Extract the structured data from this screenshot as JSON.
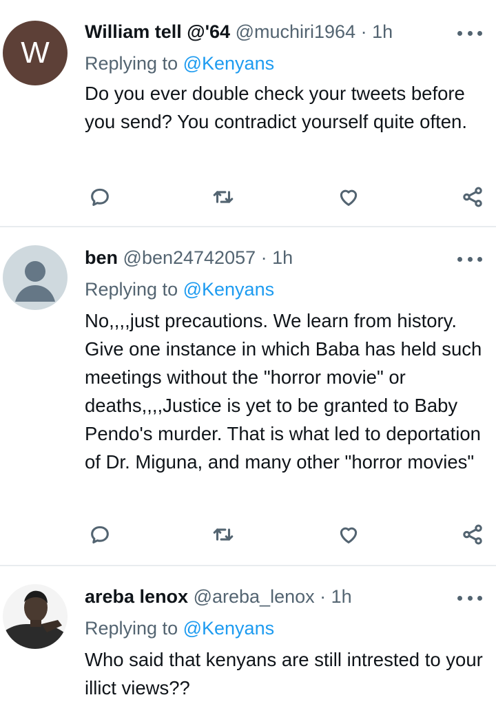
{
  "tweets": [
    {
      "avatar_letter": "W",
      "avatar_color": "#5d4037",
      "display_name": "William tell @'64",
      "handle": "@muchiri1964",
      "separator": "·",
      "time": "1h",
      "replying_prefix": "Replying to",
      "replying_to": "@Kenyans",
      "text": "Do you ever double check your tweets before you send?  You contradict yourself quite often."
    },
    {
      "avatar_color": "#cfd9de",
      "display_name": "ben",
      "handle": "@ben24742057",
      "separator": "·",
      "time": "1h",
      "replying_prefix": "Replying to",
      "replying_to": "@Kenyans",
      "text": "No,,,,just precautions. We learn from history. Give one instance in which Baba has held such meetings without the \"horror movie\" or deaths,,,,Justice is yet to be granted to Baby Pendo's murder. That is what led to deportation of Dr. Miguna, and many other \"horror movies\""
    },
    {
      "display_name": "areba lenox",
      "handle": "@areba_lenox",
      "separator": "·",
      "time": "1h",
      "replying_prefix": "Replying to",
      "replying_to": "@Kenyans",
      "text": "Who said that kenyans are still intrested to your illict views??"
    }
  ],
  "icons": {
    "reply": "reply-icon",
    "retweet": "retweet-icon",
    "like": "heart-icon",
    "share": "share-icon",
    "more": "more-icon"
  },
  "colors": {
    "mention": "#1d9bf0",
    "secondary_text": "#536471",
    "divider": "#e8ecef"
  }
}
